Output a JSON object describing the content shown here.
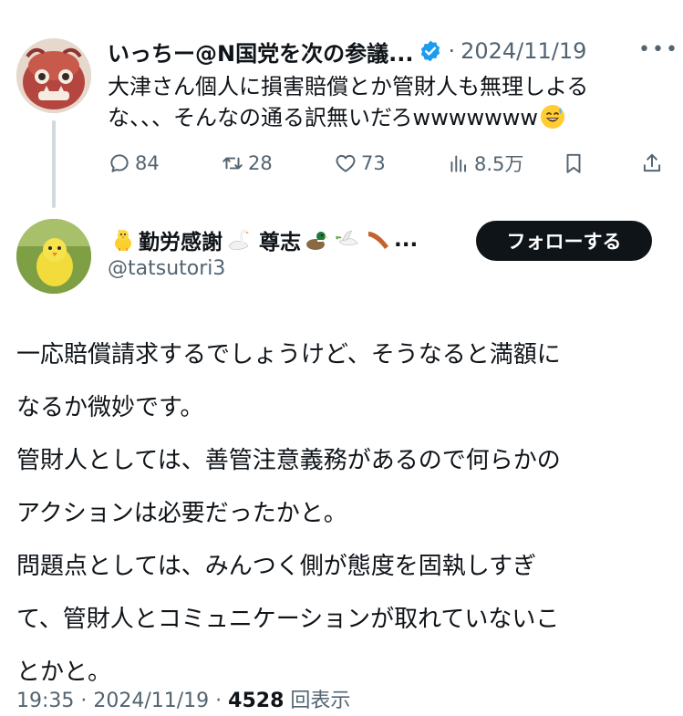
{
  "tweet1": {
    "author_name": "いっちー@N国党を次の参議...",
    "date": "2024/11/19",
    "separator": "·",
    "body_lines": [
      "大津さん個人に損害賠償とか管財人も無理しよる",
      "な、、、そんなの通る訳無いだろwwwwwww"
    ],
    "emoji_icon": "grinning-sweat-face-icon",
    "actions": {
      "reply_count": "84",
      "retweet_count": "28",
      "like_count": "73",
      "views_count": "8.5万"
    }
  },
  "tweet2": {
    "author_name_parts": [
      "勤労感謝",
      "尊志"
    ],
    "author_name_suffix": "...",
    "handle": "@tatsutori3",
    "follow_label": "フォローする",
    "body_lines": [
      {
        "before": "一応賠償請求するでしょうけど、そうなると",
        "highlight": "満額に",
        "after": ""
      },
      {
        "before": "なるか微妙です。",
        "highlight": "",
        "after": ""
      },
      {
        "before": "管財人としては、善管注意義務があるので何らかの",
        "highlight": "",
        "after": ""
      },
      {
        "before": "アクションは必要だったかと。",
        "highlight": "",
        "after": ""
      },
      {
        "before": "問題点としては、みんつく側が態度を固執しすぎ",
        "highlight": "",
        "after": ""
      },
      {
        "before": "て、管財人とコミュニケーションが取れていないこ",
        "highlight": "",
        "after": ""
      },
      {
        "before": "とかと。",
        "highlight": "",
        "after": ""
      }
    ],
    "timestamp": "19:35 · 2024/11/19 · ",
    "views_count": "4528",
    "views_label": " 回表示"
  },
  "colors": {
    "text_primary": "#0f1419",
    "text_secondary": "#536471",
    "verified_blue": "#1d9bf0",
    "highlight_yellow": "#ffd60a",
    "follow_button_bg": "#0f1419"
  }
}
